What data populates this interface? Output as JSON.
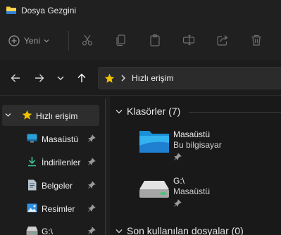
{
  "window": {
    "title": "Dosya Gezgini"
  },
  "toolbar": {
    "new_label": "Yeni",
    "icons": [
      "cut-icon",
      "copy-icon",
      "paste-icon",
      "rename-icon",
      "share-icon",
      "delete-icon"
    ]
  },
  "address": {
    "current": "Hızlı erişim"
  },
  "sidebar": {
    "items": [
      {
        "label": "Hızlı erişim",
        "icon": "star-icon",
        "selected": true
      },
      {
        "label": "Masaüstü",
        "icon": "desktop-icon",
        "pinned": true
      },
      {
        "label": "İndirilenler",
        "icon": "download-icon",
        "pinned": true
      },
      {
        "label": "Belgeler",
        "icon": "documents-icon",
        "pinned": true
      },
      {
        "label": "Resimler",
        "icon": "pictures-icon",
        "pinned": true
      },
      {
        "label": "G:\\",
        "icon": "drive-icon",
        "pinned": true
      }
    ]
  },
  "main": {
    "folders_header": "Klasörler (7)",
    "recent_header": "Son kullanılan dosyalar (0)",
    "tiles": [
      {
        "name": "Masaüstü",
        "subtitle": "Bu bilgisayar",
        "icon": "desktop-folder-icon"
      },
      {
        "name": "G:\\",
        "subtitle": "Masaüstü",
        "icon": "drive-icon"
      }
    ]
  },
  "colors": {
    "accent_star": "#f2c200",
    "folder_blue": "#1f9de0",
    "background": "#1c1c1c"
  }
}
